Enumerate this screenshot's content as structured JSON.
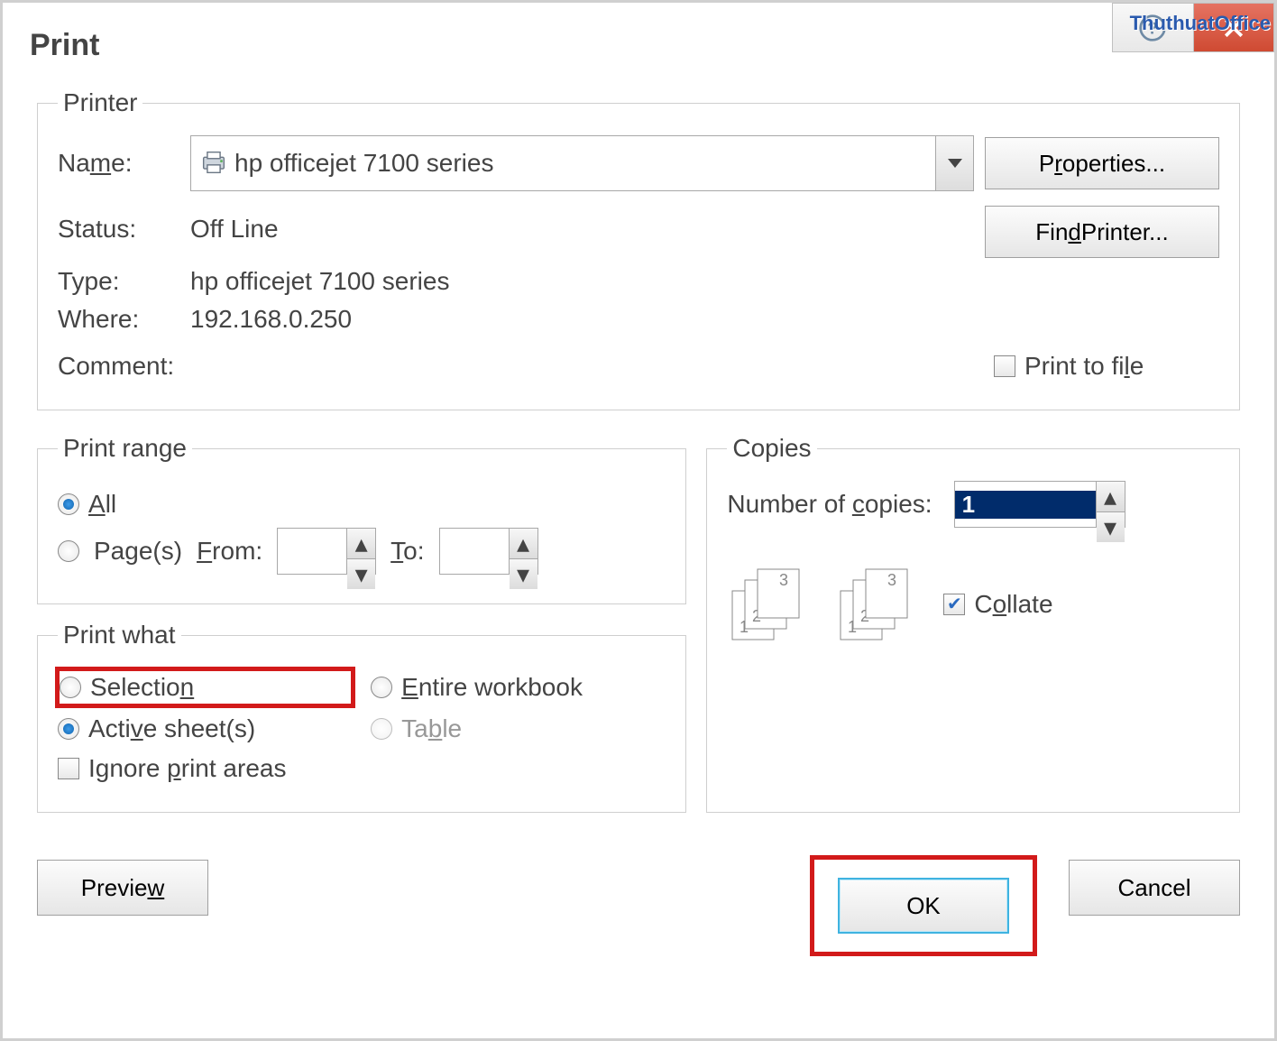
{
  "watermark": "ThuthuatOffice",
  "title": "Print",
  "printer": {
    "legend": "Printer",
    "nameLabel": "Name:",
    "nameValue": "hp officejet 7100 series",
    "propertiesBtn": "Properties...",
    "statusLabel": "Status:",
    "statusValue": "Off Line",
    "findPrinterBtn": "Find Printer...",
    "typeLabel": "Type:",
    "typeValue": "hp officejet 7100 series",
    "whereLabel": "Where:",
    "whereValue": "192.168.0.250",
    "commentLabel": "Comment:",
    "commentValue": "",
    "printToFile": "Print to file"
  },
  "printRange": {
    "legend": "Print range",
    "all": "All",
    "pages": "Page(s)",
    "from": "From:",
    "to": "To:",
    "fromValue": "",
    "toValue": ""
  },
  "printWhat": {
    "legend": "Print what",
    "selection": "Selection",
    "entireWorkbook": "Entire workbook",
    "activeSheets": "Active sheet(s)",
    "table": "Table",
    "ignorePrintAreas": "Ignore print areas"
  },
  "copies": {
    "legend": "Copies",
    "numLabel": "Number of copies:",
    "numValue": "1",
    "collate": "Collate"
  },
  "footer": {
    "preview": "Preview",
    "ok": "OK",
    "cancel": "Cancel"
  }
}
